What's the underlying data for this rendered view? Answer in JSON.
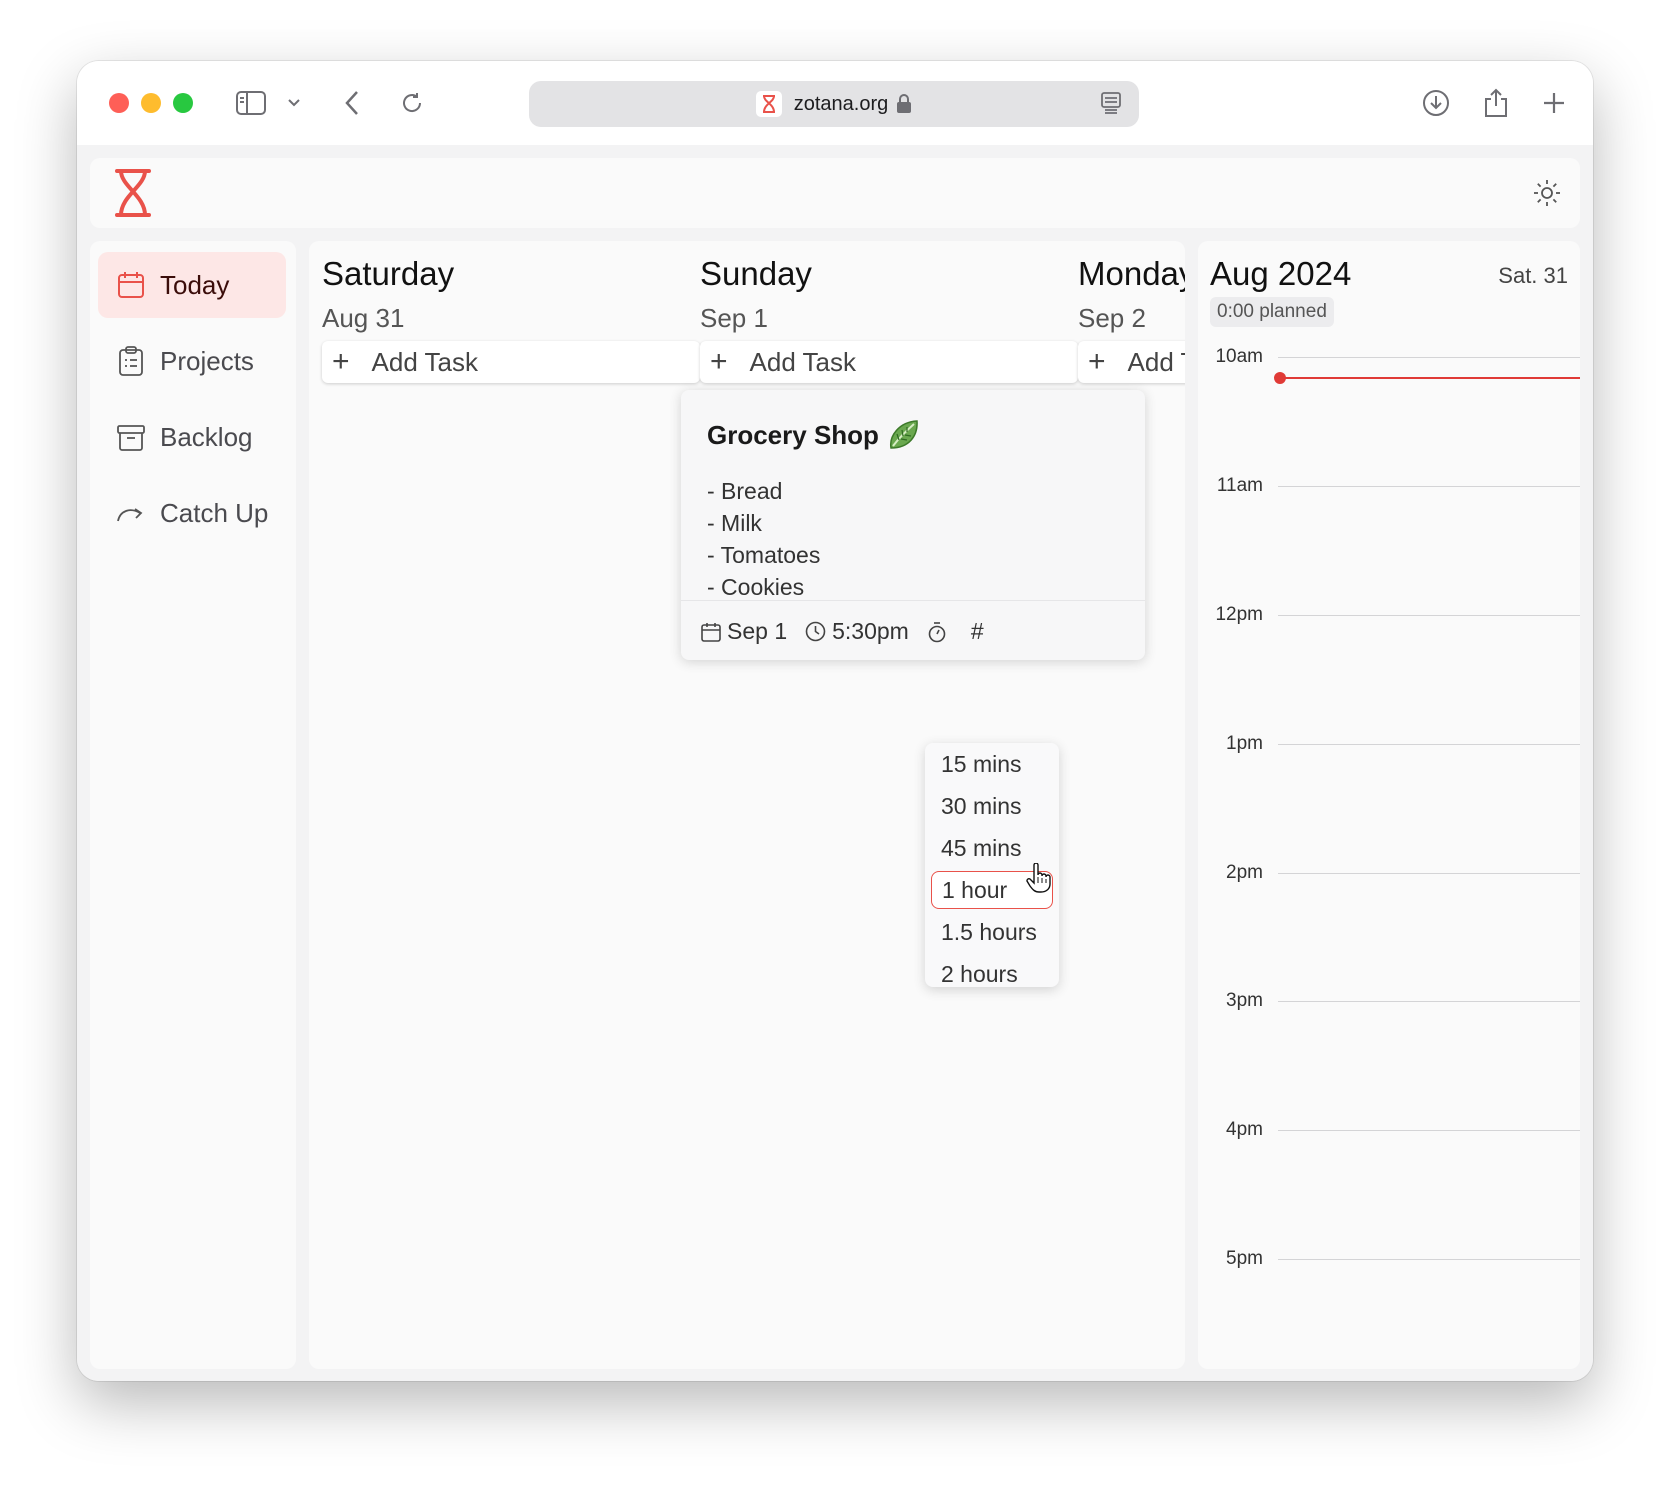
{
  "browser": {
    "url": "zotana.org"
  },
  "sidebar": {
    "items": [
      {
        "label": "Today",
        "icon": "calendar-icon",
        "active": true
      },
      {
        "label": "Projects",
        "icon": "clipboard-icon"
      },
      {
        "label": "Backlog",
        "icon": "archive-icon"
      },
      {
        "label": "Catch Up",
        "icon": "redo-arrow-icon"
      }
    ]
  },
  "days": [
    {
      "name": "Saturday",
      "date": "Aug 31",
      "add_label": "Add Task"
    },
    {
      "name": "Sunday",
      "date": "Sep 1",
      "add_label": "Add Task"
    },
    {
      "name": "Monday",
      "date": "Sep 2",
      "add_label": "Add Task"
    }
  ],
  "task": {
    "title": "Grocery Shop",
    "notes": [
      "- Bread",
      "- Milk",
      "- Tomatoes",
      "- Cookies"
    ],
    "date": "Sep 1",
    "time": "5:30pm",
    "tag_symbol": "#"
  },
  "duration_menu": {
    "options": [
      "15 mins",
      "30 mins",
      "45 mins",
      "1 hour",
      "1.5 hours",
      "2 hours"
    ],
    "selected": "1 hour"
  },
  "calendar": {
    "month": "Aug 2024",
    "day": "Sat. 31",
    "planned": "0:00 planned",
    "hours": [
      "10am",
      "11am",
      "12pm",
      "1pm",
      "2pm",
      "3pm",
      "4pm",
      "5pm"
    ]
  },
  "colors": {
    "accent": "#e9524a",
    "active_nav_bg": "#fde7e6",
    "now_line": "#e03a36"
  }
}
